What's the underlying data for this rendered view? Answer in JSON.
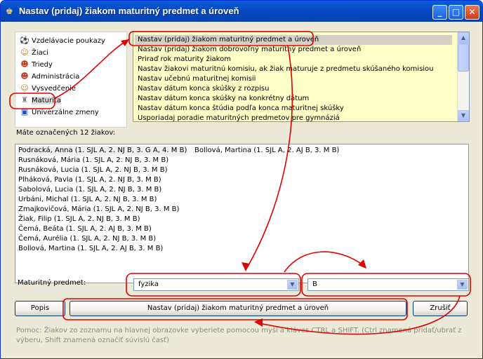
{
  "window": {
    "title": "Nastav (pridaj) žiakom maturitný predmet a úroveň"
  },
  "tree": {
    "items": [
      {
        "label": "Vzdelávacie poukazy",
        "icon": "ball-icon"
      },
      {
        "label": "Žiaci",
        "icon": "student-icon"
      },
      {
        "label": "Triedy",
        "icon": "group-icon"
      },
      {
        "label": "Administrácia",
        "icon": "admin-icon"
      },
      {
        "label": "Vysvedčenie",
        "icon": "certificate-icon"
      },
      {
        "label": "Maturita",
        "icon": "trophy-icon"
      },
      {
        "label": "Univerzálne zmeny",
        "icon": "universal-icon"
      }
    ],
    "selected": "Maturita"
  },
  "commands": [
    "Nastav (pridaj) žiakom maturitný predmet a úroveň",
    "Nastav (pridaj) žiakom dobrovoľný maturitný predmet a úroveň",
    "Priraď rok maturity žiakom",
    "Nastav žiakovi maturitnú komisiu, ak žiak maturuje z predmetu skúšaného komisiou",
    "Nastav učebnú maturitnej komisii",
    "Nastav dátum konca skúšky z rozpisu",
    "Nastav dátum konca skúšky na konkrétny dátum",
    "Nastav dátum konca štúdia podľa konca maturitnej skúšky",
    "Usporiadaj poradie maturitných predmetov pre gymnáziá"
  ],
  "students_label": "Máte označených 12 žiakov:",
  "students_first_row": [
    "Podracká, Anna (1. SJL A, 2. NJ B, 3. G A, 4. M B)",
    "Bollová, Martina (1. SJL A, 2. AJ B, 3. M B)"
  ],
  "students": [
    "Rusnáková, Mária (1. SJL A, 2. NJ B, 3. M B)",
    "Rusnáková, Lucia (1. SJL A, 2. NJ B, 3. M B)",
    "Plháková, Pavla (1. SJL A, 2. NJ B, 3. M B)",
    "Sabolová, Lucia (1. SJL A, 2. NJ B, 3. M B)",
    "Urbáni, Michal (1. SJL A, 2. NJ B, 3. M B)",
    "Zmajkovičová, Mária (1. SJL A, 2. NJ B, 3. M B)",
    "Žiak, Filip (1. SJL A, 2. NJ B, 3. M B)",
    "Čemá, Beáta (1. SJL A, 2. AJ B, 3. M B)",
    "Čemá, Aurélia (1. SJL A, 2. NJ B, 3. M B)",
    "Bollová, Martina (1. SJL A, 2. AJ B, 3. M B)"
  ],
  "subject": {
    "label": "Maturitný predmet:",
    "value": "fyzika",
    "level": "B"
  },
  "buttons": {
    "popis": "Popis",
    "apply": "Nastav (pridaj) žiakom maturitný predmet a úroveň",
    "cancel": "Zrušiť"
  },
  "help": "Pomoc: Žiakov zo zoznamu na hlavnej obrazovke vyberiete pomocou myši a kláves CTRL a SHIFT. (Ctrl znamená pridať/ubrať z výberu, Shift znamená označiť súvislú časť)",
  "colors": {
    "annotation": "#e00000",
    "command_bg": "#ffffc8",
    "title_blue": "#0549c7"
  }
}
